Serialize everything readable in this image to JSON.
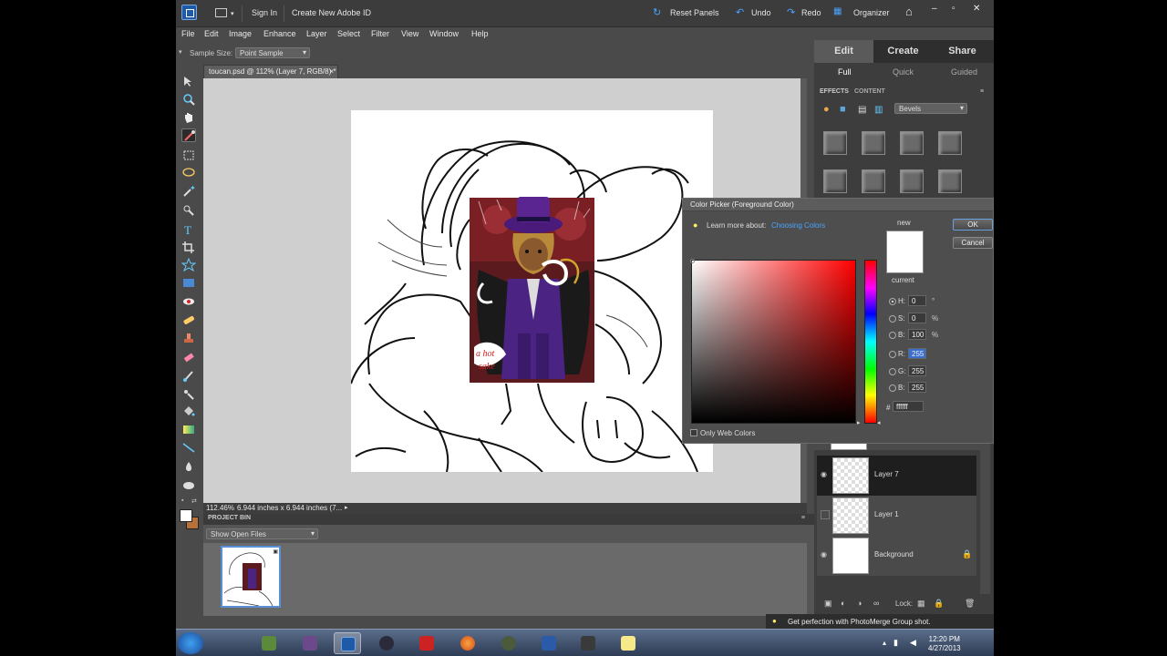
{
  "titlebar": {
    "sign_in": "Sign In",
    "create_id": "Create New Adobe ID",
    "reset_panels": "Reset Panels",
    "undo": "Undo",
    "redo": "Redo",
    "organizer": "Organizer"
  },
  "menu": [
    "File",
    "Edit",
    "Image",
    "Enhance",
    "Layer",
    "Select",
    "Filter",
    "View",
    "Window",
    "Help"
  ],
  "options": {
    "sample_size_label": "Sample Size:",
    "sample_size_value": "Point Sample"
  },
  "document": {
    "tab_title": "toucan.psd @ 112% (Layer 7, RGB/8) *",
    "zoom": "112.46%",
    "dimensions": "6.944 inches x 6.944 inches (7..."
  },
  "project_bin": {
    "title": "PROJECT BIN",
    "filter": "Show Open Files"
  },
  "panel": {
    "modes": [
      "Edit",
      "Create",
      "Share"
    ],
    "sub_modes": [
      "Full",
      "Quick",
      "Guided"
    ],
    "tabs": [
      "EFFECTS",
      "CONTENT"
    ],
    "effect_category": "Bevels"
  },
  "layers": [
    {
      "name": "Layer 7",
      "visible": true,
      "selected": true
    },
    {
      "name": "Layer 1",
      "visible": false,
      "selected": false
    },
    {
      "name": "Background",
      "visible": true,
      "selected": false,
      "locked": true
    }
  ],
  "layers_footer": {
    "lock_label": "Lock:"
  },
  "color_picker": {
    "title": "Color Picker (Foreground Color)",
    "learn_prefix": "Learn more about:",
    "learn_link": "Choosing Colors",
    "new_label": "new",
    "current_label": "current",
    "ok": "OK",
    "cancel": "Cancel",
    "fields": [
      {
        "label": "H:",
        "value": "0",
        "unit": "°",
        "checked": true
      },
      {
        "label": "S:",
        "value": "0",
        "unit": "%",
        "checked": false
      },
      {
        "label": "B:",
        "value": "100",
        "unit": "%",
        "checked": false
      },
      {
        "label": "R:",
        "value": "255",
        "unit": "",
        "checked": false,
        "selected": true
      },
      {
        "label": "G:",
        "value": "255",
        "unit": "",
        "checked": false
      },
      {
        "label": "B:",
        "value": "255",
        "unit": "",
        "checked": false
      }
    ],
    "hex_label": "#",
    "hex_value": "ffffff",
    "web_only": "Only Web Colors",
    "color": "#ffffff"
  },
  "tip": "Get perfection with PhotoMerge Group shot.",
  "clock": {
    "time": "12:20 PM",
    "date": "4/27/2013"
  }
}
